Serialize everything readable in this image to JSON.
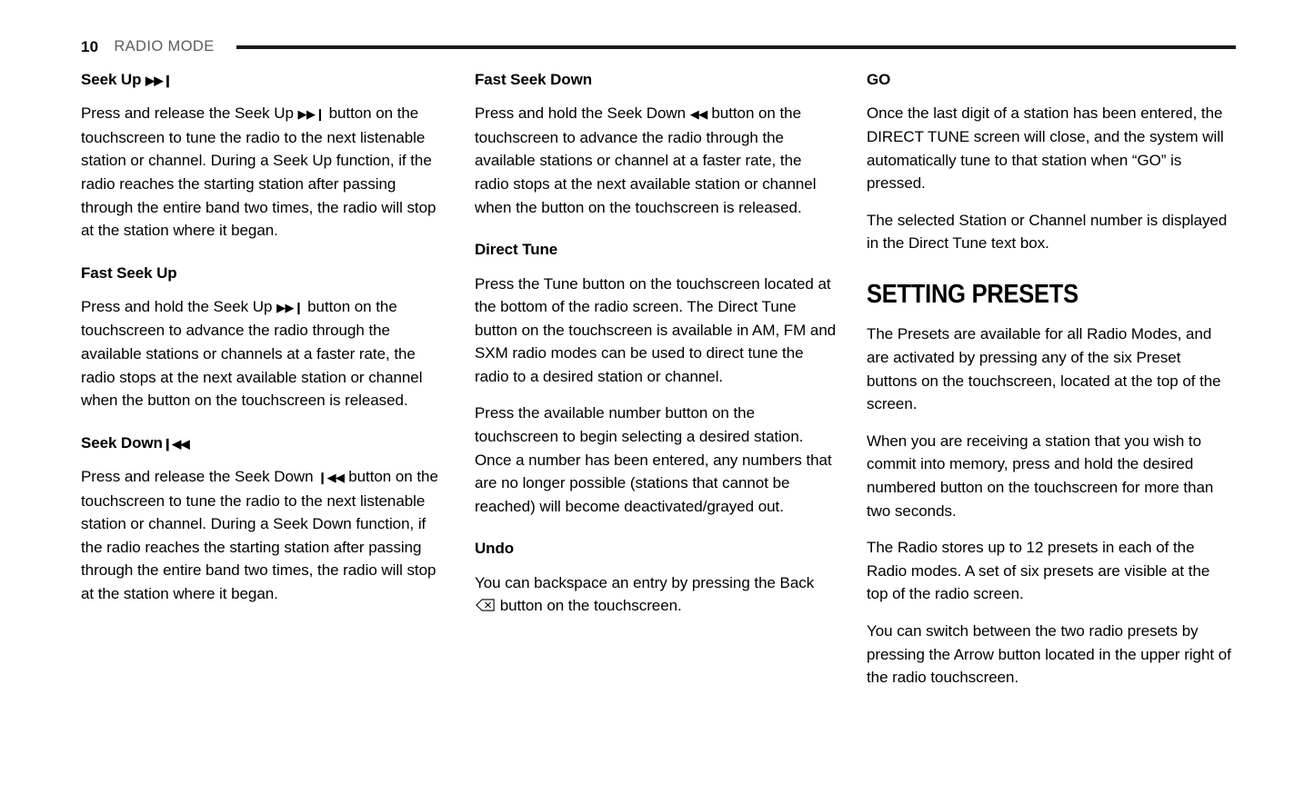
{
  "header": {
    "folio": "10",
    "title": "RADIO MODE",
    "rule_color": "#1a1a1a",
    "title_color": "#5d5d5d"
  },
  "icons": {
    "seek_up": "▶▶❙",
    "seek_down": "❙◀◀",
    "fast_seek_down": "◀◀",
    "backspace": "backspace-icon"
  },
  "columns": [
    {
      "id": "column-left",
      "blocks": [
        {
          "type": "heading",
          "name": "heading-seek-up",
          "text": "Seek Up",
          "icon": "seek-up-icon"
        },
        {
          "type": "paragraph",
          "name": "paragraph-seek-up",
          "text_before": "Press and release the Seek Up",
          "icon": "seek-up-icon",
          "text_after": "button on the touchscreen to tune the radio to the next listenable station or channel. During a Seek Up function, if the radio reaches the starting station after passing through the entire band two times, the radio will stop at the station where it began."
        },
        {
          "type": "heading",
          "name": "heading-fast-seek-up",
          "text": "Fast Seek Up",
          "icon": ""
        },
        {
          "type": "paragraph",
          "name": "paragraph-fast-seek-up",
          "text_before": "Press and hold the Seek Up",
          "icon": "seek-up-icon",
          "text_after": "button on the touchscreen to advance the radio through the available stations or channels at a faster rate, the radio stops at the next available station or channel when the button on the touchscreen is released."
        },
        {
          "type": "heading",
          "name": "heading-seek-down",
          "text": "Seek Down",
          "icon": "seek-down-icon"
        },
        {
          "type": "paragraph",
          "name": "paragraph-seek-down",
          "text_before": "Press and release the Seek Down",
          "icon": "seek-down-icon",
          "text_after": "button on the touchscreen to tune the radio to the next listenable station or channel. During a Seek Down function, if the radio reaches the starting station after passing through the entire band two times, the radio will stop at the station where it began."
        }
      ]
    },
    {
      "id": "column-middle",
      "blocks": [
        {
          "type": "heading",
          "name": "heading-fast-seek-down",
          "text": "Fast Seek Down",
          "icon": ""
        },
        {
          "type": "paragraph",
          "name": "paragraph-fast-seek-down",
          "text_before": "Press and hold the Seek Down",
          "icon": "fast-seek-down-icon",
          "text_after": "button on the touchscreen to advance the radio through the available stations or channel at a faster rate, the radio stops at the next available station or channel when the button on the touchscreen is released."
        },
        {
          "type": "heading",
          "name": "heading-direct-tune",
          "text": "Direct Tune",
          "icon": ""
        },
        {
          "type": "paragraph",
          "name": "paragraph-direct-tune-1",
          "text_before": "",
          "icon": "",
          "text_after": "Press the Tune button on the touchscreen located at the bottom of the radio screen. The Direct Tune button on the touchscreen is available in AM, FM and SXM radio modes can be used to direct tune the radio to a desired station or channel."
        },
        {
          "type": "paragraph",
          "name": "paragraph-direct-tune-2",
          "text_before": "",
          "icon": "",
          "text_after": "Press the available number button on the touchscreen to begin selecting a desired station. Once a number has been entered, any numbers that are no longer possible (stations that cannot be reached) will become deactivated/grayed out."
        },
        {
          "type": "heading",
          "name": "heading-undo",
          "text": "Undo",
          "icon": ""
        },
        {
          "type": "paragraph",
          "name": "paragraph-undo",
          "text_before": "You can backspace an entry by pressing the Back",
          "icon": "backspace-icon",
          "text_after": "button on the touchscreen."
        }
      ]
    },
    {
      "id": "column-right",
      "blocks": [
        {
          "type": "heading",
          "name": "heading-go",
          "text": "GO",
          "icon": ""
        },
        {
          "type": "paragraph",
          "name": "paragraph-go-1",
          "text_before": "",
          "icon": "",
          "text_after": "Once the last digit of a station has been entered, the DIRECT TUNE screen will close, and the system will automatically tune to that station when “GO” is pressed."
        },
        {
          "type": "paragraph",
          "name": "paragraph-go-2",
          "text_before": "",
          "icon": "",
          "text_after": "The selected Station or Channel number is displayed in the Direct Tune text box."
        },
        {
          "type": "chapter-heading",
          "name": "heading-setting-presets",
          "text": "SETTING PRESETS",
          "icon": ""
        },
        {
          "type": "paragraph",
          "name": "paragraph-presets-1",
          "text_before": "",
          "icon": "",
          "text_after": "The Presets are available for all Radio Modes, and are activated by pressing any of the six Preset buttons on the touchscreen, located at the top of the screen."
        },
        {
          "type": "paragraph",
          "name": "paragraph-presets-2",
          "text_before": "",
          "icon": "",
          "text_after": "When you are receiving a station that you wish to commit into memory, press and hold the desired numbered button on the touchscreen for more than two seconds."
        },
        {
          "type": "paragraph",
          "name": "paragraph-presets-3",
          "text_before": "",
          "icon": "",
          "text_after": "The Radio stores up to 12 presets in each of the Radio modes. A set of six presets are visible at the top of the radio screen."
        },
        {
          "type": "paragraph",
          "name": "paragraph-presets-4",
          "text_before": "",
          "icon": "",
          "text_after": "You can switch between the two radio presets by pressing the Arrow button located in the upper right of the radio touchscreen."
        }
      ]
    }
  ]
}
